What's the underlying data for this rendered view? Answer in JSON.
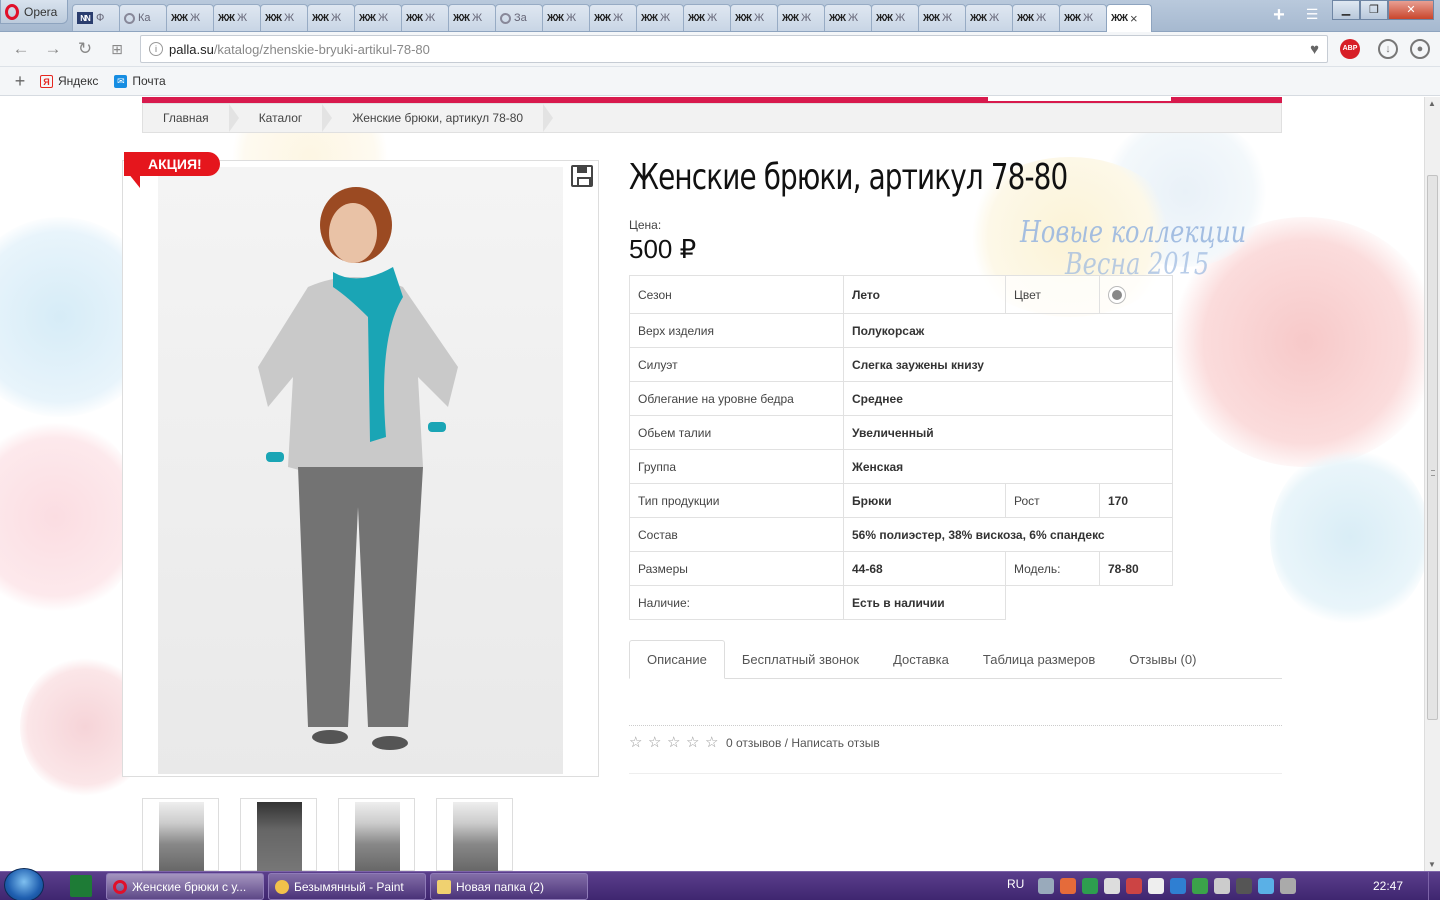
{
  "browser": {
    "app_name": "Opera",
    "tabs": [
      {
        "icon": "NN",
        "label": "Ф"
      },
      {
        "icon": "loading",
        "label": "Ка"
      },
      {
        "icon": "ЖЖ",
        "label": "Ж"
      },
      {
        "icon": "ЖЖ",
        "label": "Ж"
      },
      {
        "icon": "ЖЖ",
        "label": "Ж"
      },
      {
        "icon": "ЖЖ",
        "label": "Ж"
      },
      {
        "icon": "ЖЖ",
        "label": "Ж"
      },
      {
        "icon": "ЖЖ",
        "label": "Ж"
      },
      {
        "icon": "ЖЖ",
        "label": "Ж"
      },
      {
        "icon": "loading",
        "label": "За"
      },
      {
        "icon": "ЖЖ",
        "label": "Ж"
      },
      {
        "icon": "ЖЖ",
        "label": "Ж"
      },
      {
        "icon": "ЖЖ",
        "label": "Ж"
      },
      {
        "icon": "ЖЖ",
        "label": "Ж"
      },
      {
        "icon": "ЖЖ",
        "label": "Ж"
      },
      {
        "icon": "ЖЖ",
        "label": "Ж"
      },
      {
        "icon": "ЖЖ",
        "label": "Ж"
      },
      {
        "icon": "ЖЖ",
        "label": "Ж"
      },
      {
        "icon": "ЖЖ",
        "label": "Ж"
      },
      {
        "icon": "ЖЖ",
        "label": "Ж"
      },
      {
        "icon": "ЖЖ",
        "label": "Ж"
      },
      {
        "icon": "ЖЖ",
        "label": "Ж"
      }
    ],
    "active_tab": {
      "icon": "ЖЖ",
      "close": "×"
    },
    "new_tab": "+",
    "url_domain": "palla.su",
    "url_path": "/katalog/zhenskie-bryuki-artikul-78-80",
    "bookmarks": [
      {
        "icon": "Я",
        "label": "Яндекс"
      },
      {
        "icon": "✉",
        "label": "Почта"
      }
    ],
    "adblock_label": "ABP"
  },
  "page": {
    "breadcrumb": [
      "Главная",
      "Каталог",
      "Женские брюки, артикул 78-80"
    ],
    "sale_badge": "АКЦИЯ!",
    "title": "Женские брюки, артикул 78-80",
    "price_label": "Цена:",
    "price": "500 ₽",
    "watermark_line1": "Новые коллекции",
    "watermark_line2": "Весна 2015",
    "specs": {
      "row1": {
        "k": "Сезон",
        "v": "Лето",
        "k2": "Цвет",
        "color": "#888888"
      },
      "row2": {
        "k": "Верх изделия",
        "v": "Полукорсаж"
      },
      "row3": {
        "k": "Силуэт",
        "v": "Слегка заужены книзу"
      },
      "row4": {
        "k": "Облегание на уровне бедра",
        "v": "Среднее"
      },
      "row5": {
        "k": "Обьем талии",
        "v": "Увеличенный"
      },
      "row6": {
        "k": "Группа",
        "v": "Женская"
      },
      "row7": {
        "k": "Тип продукции",
        "v": "Брюки",
        "k2": "Рост",
        "v2": "170"
      },
      "row8": {
        "k": "Состав",
        "v": "56% полиэстер, 38% вискоза, 6% спандекс"
      },
      "row9": {
        "k": "Размеры",
        "v": "44-68",
        "k2": "Модель:",
        "v2": "78-80"
      },
      "row10": {
        "k": "Наличие:",
        "v": "Есть в наличии"
      }
    },
    "tabs": [
      "Описание",
      "Бесплатный звонок",
      "Доставка",
      "Таблица размеров",
      "Отзывы (0)"
    ],
    "reviews_text": "0 отзывов / Написать отзыв",
    "rating_stars": 0
  },
  "taskbar": {
    "tasks": [
      {
        "label": "Женские брюки с у..."
      },
      {
        "label": "Безымянный - Paint"
      },
      {
        "label": "Новая папка (2)"
      }
    ],
    "lang": "RU",
    "clock": "22:47"
  },
  "colors": {
    "accent": "#d81a4d",
    "sale": "#e5161d",
    "taskbar": "#4a3079"
  }
}
